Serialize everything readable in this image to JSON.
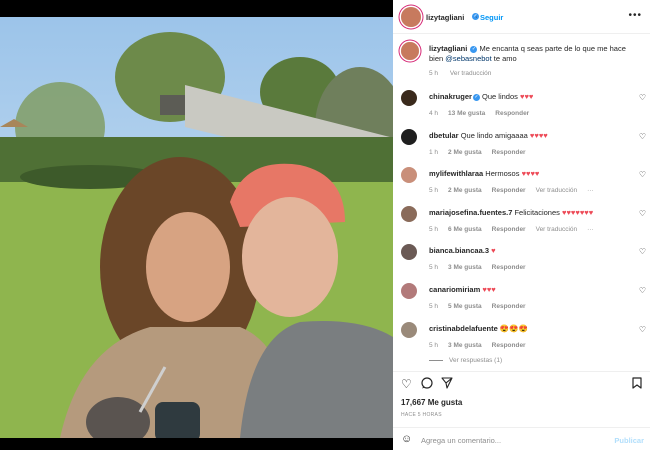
{
  "post": {
    "author": "lizytagliani",
    "follow_label": "Seguir",
    "more_label": "•••",
    "caption": "Me encanta q seas parte de lo que me hace bien",
    "caption_mention": "@sebasnebot",
    "caption_tail": "te amo",
    "caption_time": "5 h",
    "caption_translate": "Ver traducción"
  },
  "comments": [
    {
      "user": "chinakruger",
      "verified": true,
      "text": "Que lindos",
      "emoji": "♥♥♥",
      "time": "4 h",
      "likes": "13 Me gusta",
      "reply": "Responder",
      "translate": "",
      "avatar_color": "#3a2a1c"
    },
    {
      "user": "dbetular",
      "verified": false,
      "text": "Que lindo amigaaaa",
      "emoji": "♥♥♥♥",
      "time": "1 h",
      "likes": "2 Me gusta",
      "reply": "Responder",
      "translate": "",
      "avatar_color": "#1f1f1f"
    },
    {
      "user": "mylifewithlaraa",
      "verified": false,
      "text": "Hermosos",
      "emoji": "♥♥♥♥",
      "time": "5 h",
      "likes": "2 Me gusta",
      "reply": "Responder",
      "translate": "Ver traducción",
      "avatar_color": "#c98f7a"
    },
    {
      "user": "mariajosefina.fuentes.7",
      "verified": false,
      "text": "Felicitaciones",
      "emoji": "♥♥♥♥♥♥♥",
      "time": "5 h",
      "likes": "6 Me gusta",
      "reply": "Responder",
      "translate": "Ver traducción",
      "avatar_color": "#8a6b5a"
    },
    {
      "user": "bianca.biancaa.3",
      "verified": false,
      "text": "",
      "emoji": "♥",
      "time": "5 h",
      "likes": "3 Me gusta",
      "reply": "Responder",
      "translate": "",
      "avatar_color": "#6b5a55"
    },
    {
      "user": "canariomiriam",
      "verified": false,
      "text": "",
      "emoji": "♥♥♥",
      "time": "5 h",
      "likes": "5 Me gusta",
      "reply": "Responder",
      "translate": "",
      "avatar_color": "#b27a7a"
    },
    {
      "user": "cristinabdelafuente",
      "verified": false,
      "text": "",
      "emoji": "😍😍😍",
      "time": "5 h",
      "likes": "3 Me gusta",
      "reply": "Responder",
      "translate": "",
      "avatar_color": "#9a8a7a"
    }
  ],
  "view_replies": "Ver respuestas (1)",
  "actions": {
    "like_icon": "heart-outline-icon",
    "comment_icon": "comment-icon",
    "share_icon": "paper-plane-icon",
    "save_icon": "bookmark-icon",
    "likes_count": "17,667 Me gusta",
    "posted_ago": "HACE 5 HORAS",
    "comment_placeholder": "Agrega un comentario...",
    "publish_label": "Publicar"
  },
  "colors": {
    "accent": "#0095f6",
    "heart_red": "#ed4956",
    "verified": "#3897f0"
  }
}
